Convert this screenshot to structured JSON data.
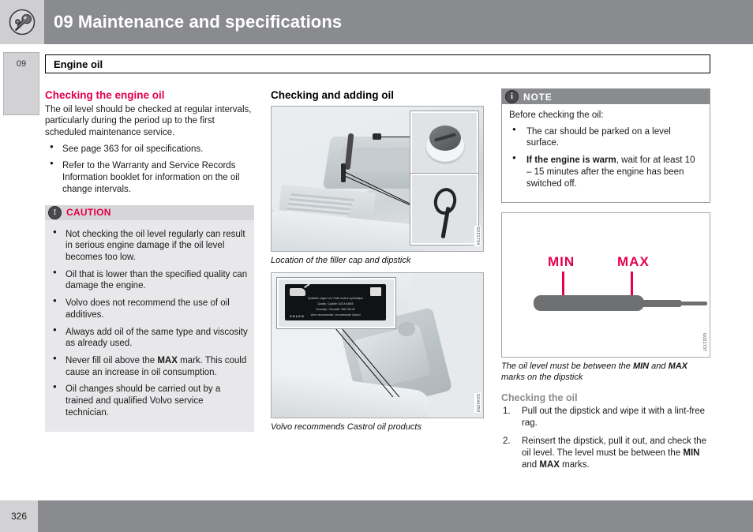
{
  "header": {
    "title": "09 Maintenance and specifications",
    "icon": "wrench-circle-icon",
    "band_color": "#8a8b8f"
  },
  "chapter_tab": {
    "number": "09"
  },
  "section": {
    "title": "Engine oil"
  },
  "left_column": {
    "heading": "Checking the engine oil",
    "heading_color": "#e4004b",
    "intro": "The oil level should be checked at regular intervals, particularly during the period up to the first scheduled maintenance service.",
    "bullets": [
      "See page 363 for oil specifications.",
      "Refer to the Warranty and Service Records Information booklet for information on the oil change intervals."
    ],
    "caution": {
      "label": "CAUTION",
      "icon": "exclamation-circle-icon",
      "label_color": "#e4004b",
      "bullets": [
        "Not checking the oil level regularly can result in serious engine damage if the oil level becomes too low.",
        "Oil that is lower than the specified quality can damage the engine.",
        "Volvo does not recommend the use of oil additives.",
        "Always add oil of the same type and viscosity as already used.",
        "Never fill oil above the MAX mark. This could cause an increase in oil consumption.",
        "Oil changes should be carried out by a trained and qualified Volvo service technician."
      ],
      "bold_terms": [
        "MAX"
      ]
    }
  },
  "middle_column": {
    "heading": "Checking and adding oil",
    "figure1": {
      "name": "engine-bay-filler-cap-dipstick",
      "code": "G021734",
      "caption": "Location of the filler cap and dipstick",
      "insets": [
        "oil-filler-cap",
        "dipstick-handle"
      ]
    },
    "figure2": {
      "name": "engine-bay-castrol-label",
      "code": "G044259",
      "caption": "Volvo recommends Castrol oil products",
      "label_lines": [
        "Synthetic engine oil / Huile moteur synthétique",
        "Quality / Qualité: ACEA A5/B5",
        "Viscosity / Viscosité: SAE 0W-30",
        "Volvo recommends / recommande Castrol"
      ],
      "label_brand": "VOLVO"
    }
  },
  "right_column": {
    "note": {
      "label": "NOTE",
      "icon": "info-circle-icon",
      "intro": "Before checking the oil:",
      "bullets": [
        "The car should be parked on a level surface.",
        "If the engine is warm, wait for at least 10 – 15 minutes after the engine has been switched off."
      ],
      "bold_terms": [
        "If the engine is warm"
      ]
    },
    "figure3": {
      "name": "dipstick-min-max-diagram",
      "code": "G021737",
      "min_label": "MIN",
      "max_label": "MAX",
      "mark_color": "#e4004b",
      "caption": "The oil level must be between the MIN and MAX marks on the dipstick"
    },
    "subheading": "Checking the oil",
    "subheading_color": "#8a8b8f",
    "steps": [
      "Pull out the dipstick and wipe it with a lint-free rag.",
      "Reinsert the dipstick, pull it out, and check the oil level. The level must be between the MIN and MAX marks."
    ]
  },
  "footer": {
    "page_number": "326",
    "band_color": "#8a8b8f"
  }
}
